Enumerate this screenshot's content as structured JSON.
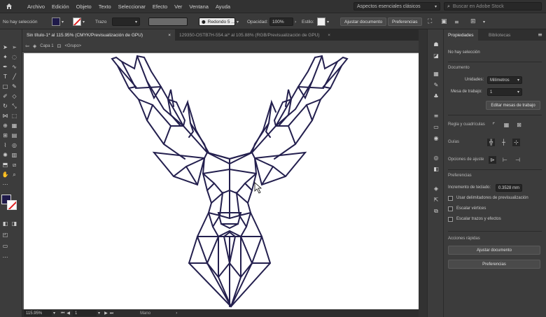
{
  "menubar": {
    "items": [
      "Archivo",
      "Edición",
      "Objeto",
      "Texto",
      "Seleccionar",
      "Efecto",
      "Ver",
      "Ventana",
      "Ayuda"
    ],
    "workspace": "Aspectos esenciales clásicos",
    "search_placeholder": "Buscar en Adobe Stock"
  },
  "control": {
    "selection": "No hay selección",
    "stroke_label": "Trazo",
    "brush": "Redondo 5 ...",
    "opacity_label": "Opacidad:",
    "opacity_value": "100%",
    "style_label": "Estilo:",
    "adjust_doc": "Ajustar documento",
    "prefs": "Preferencias",
    "fill_color": "#1f1a4a"
  },
  "tabs": [
    {
      "label": "Sin título-1* al 115.95% (CMYK/Previsualización de GPU)",
      "close": "×"
    },
    {
      "label": "129350-OSTB7H-554.ai* al 105.88% (RGB/Previsualización de GPU)",
      "close": "×"
    }
  ],
  "layerbar": {
    "layer": "Capa 1",
    "group": "<Grupo>"
  },
  "status": {
    "zoom": "115.95%",
    "artboard": "1",
    "tool": "Mano"
  },
  "panel": {
    "tabs": [
      "Propiedades",
      "Bibliotecas"
    ],
    "no_selection": "No hay selección",
    "document_title": "Documento",
    "units_label": "Unidades:",
    "units_value": "Milímetros",
    "artboard_label": "Mesa de trabajo:",
    "artboard_value": "1",
    "edit_artboards": "Editar mesas de trabajo",
    "rulers_grids": "Regla y cuadrículas",
    "guides": "Guías",
    "snap_options": "Opciones de ajuste",
    "preferences_title": "Preferencias",
    "keyboard_inc_label": "Incremento de teclado:",
    "keyboard_inc_value": "0.3528 mm",
    "chk_preview_bounds": "Usar delimitadores de previsualización",
    "chk_scale_corners": "Escalar vértices",
    "chk_scale_strokes": "Escalar trazos y efectos",
    "quick_actions": "Acciones rápidas",
    "btn_adjust_doc": "Ajustar documento",
    "btn_prefs": "Preferencias"
  },
  "art": {
    "stroke_color": "#231f4e"
  }
}
